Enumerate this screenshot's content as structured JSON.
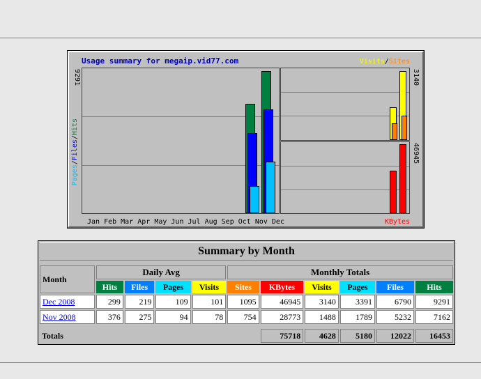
{
  "graph": {
    "title": "Usage summary for megaip.vid77.com",
    "legend_visits": "Visits",
    "legend_sep": "/",
    "legend_sites": "Sites",
    "left_labels": {
      "pages": "Pages",
      "sep1": "/",
      "files": "Files",
      "sep2": "/",
      "hits": "Hits"
    },
    "max_hits_label": "9291",
    "max_visits_label": "3140",
    "max_kbytes_label": "46945",
    "months_text": "Jan Feb Mar Apr May Jun Jul Aug Sep Oct Nov Dec",
    "kbytes_label": "KBytes",
    "colors": {
      "hits": "#008040",
      "files": "#0000ff",
      "pages": "#00c0ff",
      "visits": "#ffff00",
      "sites": "#ff8000",
      "kbytes": "#ff0000"
    }
  },
  "chart_data": {
    "type": "bar",
    "categories": [
      "Jan",
      "Feb",
      "Mar",
      "Apr",
      "May",
      "Jun",
      "Jul",
      "Aug",
      "Sep",
      "Oct",
      "Nov",
      "Dec"
    ],
    "series": [
      {
        "name": "Hits",
        "values": [
          0,
          0,
          0,
          0,
          0,
          0,
          0,
          0,
          0,
          0,
          7162,
          9291
        ]
      },
      {
        "name": "Files",
        "values": [
          0,
          0,
          0,
          0,
          0,
          0,
          0,
          0,
          0,
          0,
          5232,
          6790
        ]
      },
      {
        "name": "Pages",
        "values": [
          0,
          0,
          0,
          0,
          0,
          0,
          0,
          0,
          0,
          0,
          1789,
          3391
        ]
      },
      {
        "name": "Visits",
        "values": [
          0,
          0,
          0,
          0,
          0,
          0,
          0,
          0,
          0,
          0,
          1488,
          3140
        ]
      },
      {
        "name": "Sites",
        "values": [
          0,
          0,
          0,
          0,
          0,
          0,
          0,
          0,
          0,
          0,
          754,
          1095
        ]
      },
      {
        "name": "KBytes",
        "values": [
          0,
          0,
          0,
          0,
          0,
          0,
          0,
          0,
          0,
          0,
          28773,
          46945
        ]
      }
    ]
  },
  "table": {
    "title": "Summary by Month",
    "month_header": "Month",
    "daily_avg_header": "Daily Avg",
    "monthly_totals_header": "Monthly Totals",
    "col_hits": "Hits",
    "col_files": "Files",
    "col_pages": "Pages",
    "col_visits": "Visits",
    "col_sites": "Sites",
    "col_kbytes": "KBytes",
    "rows": [
      {
        "month": "Dec 2008",
        "avg_hits": "299",
        "avg_files": "219",
        "avg_pages": "109",
        "avg_visits": "101",
        "sites": "1095",
        "kbytes": "46945",
        "visits": "3140",
        "pages": "3391",
        "files": "6790",
        "hits": "9291"
      },
      {
        "month": "Nov 2008",
        "avg_hits": "376",
        "avg_files": "275",
        "avg_pages": "94",
        "avg_visits": "78",
        "sites": "754",
        "kbytes": "28773",
        "visits": "1488",
        "pages": "1789",
        "files": "5232",
        "hits": "7162"
      }
    ],
    "totals_label": "Totals",
    "totals": {
      "kbytes": "75718",
      "visits": "4628",
      "pages": "5180",
      "files": "12022",
      "hits": "16453"
    }
  }
}
